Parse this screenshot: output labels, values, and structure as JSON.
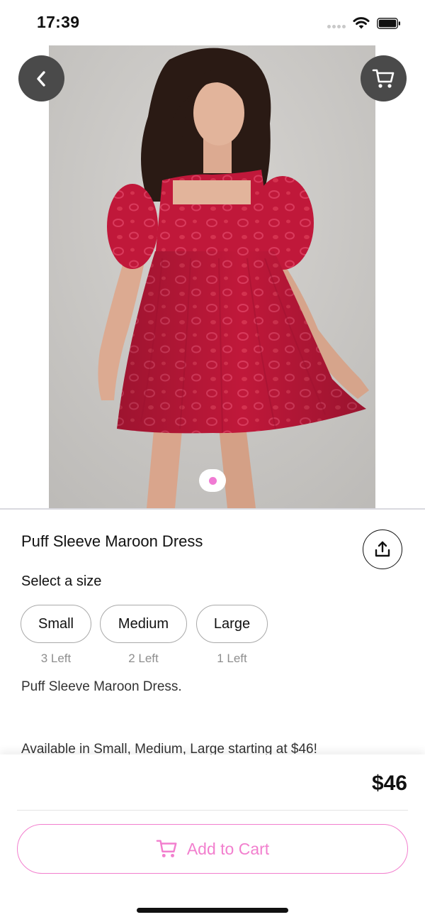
{
  "status_bar": {
    "time": "17:39"
  },
  "product": {
    "title": "Puff Sleeve Maroon Dress",
    "image_dot_count": 1,
    "select_size_label": "Select a size",
    "sizes": [
      {
        "label": "Small",
        "stock": "3 Left"
      },
      {
        "label": "Medium",
        "stock": "2 Left"
      },
      {
        "label": "Large",
        "stock": "1 Left"
      }
    ],
    "description": "Puff Sleeve Maroon Dress.",
    "availability": "Available in Small, Medium, Large starting at $46!"
  },
  "footer": {
    "price": "$46",
    "add_to_cart_label": "Add to Cart"
  },
  "icons": {
    "back": "chevron-left-icon",
    "cart": "cart-icon",
    "share": "share-icon",
    "add_to_cart": "cart-icon"
  },
  "colors": {
    "accent": "#f27fce",
    "indicator_dot": "#f07ad3",
    "dress": "#c0183a",
    "round_button_bg": "#4a4a4a"
  }
}
